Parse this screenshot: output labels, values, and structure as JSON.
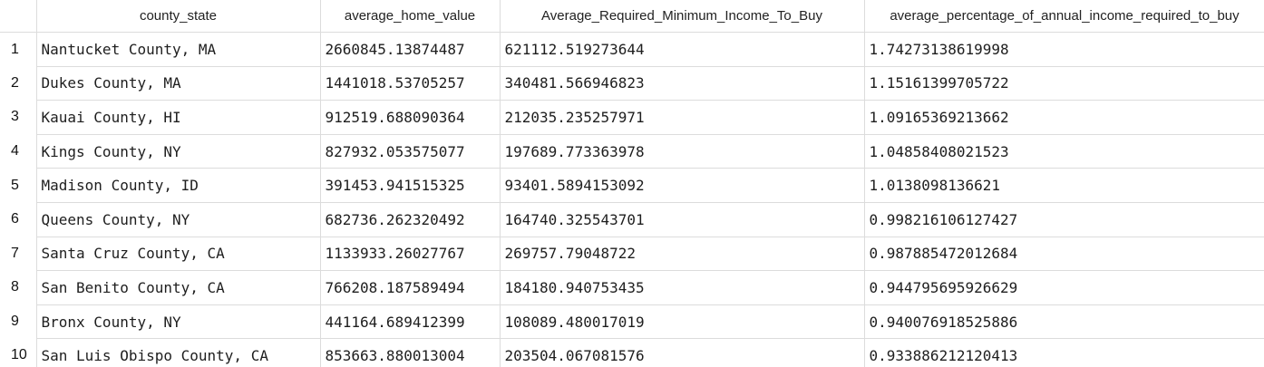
{
  "table": {
    "columns": [
      "county_state",
      "average_home_value",
      "Average_Required_Minimum_Income_To_Buy",
      "average_percentage_of_annual_income_required_to_buy"
    ],
    "rows": [
      {
        "index": "1",
        "county_state": "Nantucket County, MA",
        "average_home_value": "2660845.13874487",
        "min_income": "621112.519273644",
        "pct_income": "1.74273138619998"
      },
      {
        "index": "2",
        "county_state": "Dukes County, MA",
        "average_home_value": "1441018.53705257",
        "min_income": "340481.566946823",
        "pct_income": "1.15161399705722"
      },
      {
        "index": "3",
        "county_state": "Kauai County, HI",
        "average_home_value": "912519.688090364",
        "min_income": "212035.235257971",
        "pct_income": "1.09165369213662"
      },
      {
        "index": "4",
        "county_state": "Kings County, NY",
        "average_home_value": "827932.053575077",
        "min_income": "197689.773363978",
        "pct_income": "1.04858408021523"
      },
      {
        "index": "5",
        "county_state": "Madison County, ID",
        "average_home_value": "391453.941515325",
        "min_income": "93401.5894153092",
        "pct_income": "1.0138098136621"
      },
      {
        "index": "6",
        "county_state": "Queens County, NY",
        "average_home_value": "682736.262320492",
        "min_income": "164740.325543701",
        "pct_income": "0.998216106127427"
      },
      {
        "index": "7",
        "county_state": "Santa Cruz County, CA",
        "average_home_value": "1133933.26027767",
        "min_income": "269757.79048722",
        "pct_income": "0.987885472012684"
      },
      {
        "index": "8",
        "county_state": "San Benito County, CA",
        "average_home_value": "766208.187589494",
        "min_income": "184180.940753435",
        "pct_income": "0.944795695926629"
      },
      {
        "index": "9",
        "county_state": "Bronx County, NY",
        "average_home_value": "441164.689412399",
        "min_income": "108089.480017019",
        "pct_income": "0.940076918525886"
      },
      {
        "index": "10",
        "county_state": "San Luis Obispo County, CA",
        "average_home_value": "853663.880013004",
        "min_income": "203504.067081576",
        "pct_income": "0.933886212120413"
      }
    ]
  }
}
